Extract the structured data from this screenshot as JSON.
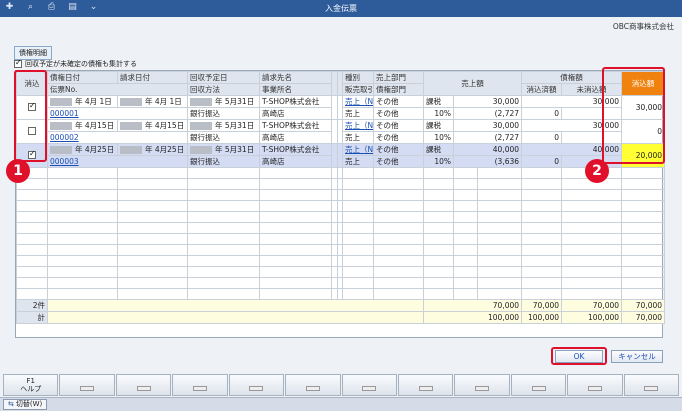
{
  "window": {
    "title": "入金伝票"
  },
  "company": "OBC商事株式会社",
  "section_label": "債権明細",
  "collect_checkbox": {
    "label": "回収予定が未確定の債権も集計する",
    "checked": true
  },
  "headers": {
    "keshikomi": "消込",
    "saiken_date": "債権日付",
    "seikyu_date": "請求日付",
    "denpyo_no": "伝票No.",
    "kaishu_date": "回収予定日",
    "kaishu_method": "回収方法",
    "seikyusaki": "請求先名",
    "jigyosho": "事業所名",
    "shubetsu": "種別",
    "hanbai": "販売取引",
    "uriage_bumon": "売上部門",
    "saiken_bumon": "債権部門",
    "uriage_gaku": "売上額",
    "saiken_gaku": "債権額",
    "keshikomi_zumi": "消込済額",
    "mi_keshikomi": "未消込額",
    "keshikomi_gaku": "消込額"
  },
  "rows": [
    {
      "checked": true,
      "saiken_date": "年 4月 1日",
      "seikyu_date": "年 4月 1日",
      "denpyo_no": "000001",
      "kaishu_date": "年 5月31日",
      "kaishu_method": "銀行振込",
      "seikyusaki": "T-SHOP株式会社",
      "jigyosho": "高崎店",
      "shubetsu": "売上（N",
      "hanbai": "売上",
      "uriage_bumon": "その他",
      "saiken_bumon": "その他",
      "tax_type": "課税",
      "tax_rate": "10%",
      "uriage_gaku": "30,000",
      "tax_amount": "(2,727",
      "saiken_gaku": "30,000",
      "keshikomi_zumi": "0",
      "mi_keshikomi": "30,000",
      "keshikomi_gaku": "30,000",
      "selected": false
    },
    {
      "checked": false,
      "saiken_date": "年 4月15日",
      "seikyu_date": "年 4月15日",
      "denpyo_no": "000002",
      "kaishu_date": "年 5月31日",
      "kaishu_method": "銀行振込",
      "seikyusaki": "T-SHOP株式会社",
      "jigyosho": "高崎店",
      "shubetsu": "売上（N",
      "hanbai": "売上",
      "uriage_bumon": "その他",
      "saiken_bumon": "その他",
      "tax_type": "課税",
      "tax_rate": "10%",
      "uriage_gaku": "30,000",
      "tax_amount": "(2,727",
      "saiken_gaku": "30,000",
      "keshikomi_zumi": "0",
      "mi_keshikomi": "30,000",
      "keshikomi_gaku": "0",
      "selected": false
    },
    {
      "checked": true,
      "saiken_date": "年 4月25日",
      "seikyu_date": "年 4月25日",
      "denpyo_no": "000003",
      "kaishu_date": "年 5月31日",
      "kaishu_method": "銀行振込",
      "seikyusaki": "T-SHOP株式会社",
      "jigyosho": "高崎店",
      "shubetsu": "売上（N",
      "hanbai": "売上",
      "uriage_bumon": "その他",
      "saiken_bumon": "その他",
      "tax_type": "課税",
      "tax_rate": "10%",
      "uriage_gaku": "40,000",
      "tax_amount": "(3,636",
      "saiken_gaku": "40,000",
      "keshikomi_zumi": "0",
      "mi_keshikomi": "40,000",
      "keshikomi_gaku": "20,000",
      "selected": true
    }
  ],
  "totals": {
    "count_label": "2件",
    "total_label": "計",
    "sel_uriage": "70,000",
    "sel_saiken": "70,000",
    "sel_mi": "70,000",
    "sel_keshikomi": "70,000",
    "all_uriage": "100,000",
    "all_saiken": "100,000",
    "all_mi": "100,000",
    "all_keshikomi": "70,000"
  },
  "buttons": {
    "ok": "OK",
    "cancel": "キャンセル"
  },
  "fkeys": [
    {
      "key": "F1",
      "label": "ヘルプ"
    },
    {
      "key": "",
      "label": ""
    },
    {
      "key": "",
      "label": ""
    },
    {
      "key": "",
      "label": ""
    },
    {
      "key": "",
      "label": ""
    },
    {
      "key": "",
      "label": ""
    },
    {
      "key": "",
      "label": ""
    },
    {
      "key": "",
      "label": ""
    },
    {
      "key": "",
      "label": ""
    },
    {
      "key": "",
      "label": ""
    },
    {
      "key": "",
      "label": ""
    },
    {
      "key": "",
      "label": ""
    }
  ],
  "status": {
    "switch_label": "切替(W)"
  },
  "badges": [
    "1",
    "2"
  ],
  "colors": {
    "title_bar": "#2e5b9a",
    "highlight_red": "#e0102a",
    "keshikomi_header": "#f0820f",
    "input_yellow": "#ffff33"
  }
}
